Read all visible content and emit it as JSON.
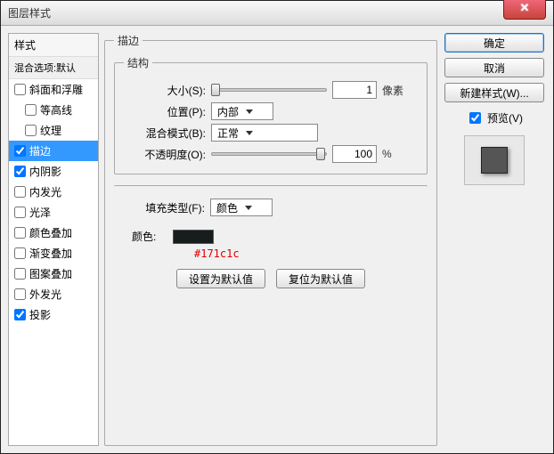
{
  "window": {
    "title": "图层样式"
  },
  "sidebar": {
    "header": "样式",
    "blending": "混合选项:默认",
    "items": [
      {
        "label": "斜面和浮雕",
        "checked": false,
        "indent": false
      },
      {
        "label": "等高线",
        "checked": false,
        "indent": true
      },
      {
        "label": "纹理",
        "checked": false,
        "indent": true
      },
      {
        "label": "描边",
        "checked": true,
        "indent": false,
        "selected": true
      },
      {
        "label": "内阴影",
        "checked": true,
        "indent": false
      },
      {
        "label": "内发光",
        "checked": false,
        "indent": false
      },
      {
        "label": "光泽",
        "checked": false,
        "indent": false
      },
      {
        "label": "颜色叠加",
        "checked": false,
        "indent": false
      },
      {
        "label": "渐变叠加",
        "checked": false,
        "indent": false
      },
      {
        "label": "图案叠加",
        "checked": false,
        "indent": false
      },
      {
        "label": "外发光",
        "checked": false,
        "indent": false
      },
      {
        "label": "投影",
        "checked": true,
        "indent": false
      }
    ]
  },
  "stroke": {
    "group_label": "描边",
    "structure_label": "结构",
    "size_label": "大小(S):",
    "size_value": "1",
    "size_unit": "像素",
    "position_label": "位置(P):",
    "position_value": "内部",
    "blend_label": "混合模式(B):",
    "blend_value": "正常",
    "opacity_label": "不透明度(O):",
    "opacity_value": "100",
    "opacity_unit": "%",
    "filltype_label": "填充类型(F):",
    "filltype_value": "颜色",
    "color_label": "颜色:",
    "color_hex": "#171c1c",
    "reset_btn": "设置为默认值",
    "restore_btn": "复位为默认值"
  },
  "right": {
    "ok": "确定",
    "cancel": "取消",
    "newstyle": "新建样式(W)...",
    "preview_label": "预览(V)"
  }
}
